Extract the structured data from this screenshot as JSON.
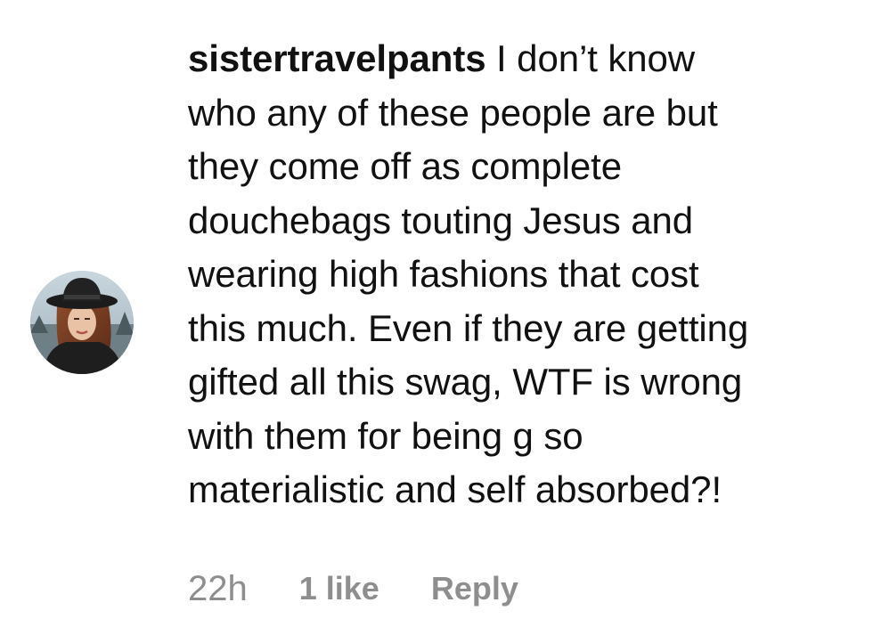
{
  "comment": {
    "username": "sistertravelpants",
    "text_lines": [
      "I don’t know",
      "who any of these people are but",
      "they come off as complete",
      "douchebags touting Jesus and",
      "wearing high fashions that cost",
      "this much. Even if they are getting",
      "gifted all this swag, WTF is wrong",
      "with them for being g so",
      "materialistic and self absorbed?!"
    ],
    "timestamp": "22h",
    "likes": "1 like",
    "reply_label": "Reply",
    "avatar_icon": "user-avatar-photo"
  },
  "colors": {
    "text": "#111111",
    "meta": "#8e8e8e",
    "background": "#ffffff"
  }
}
